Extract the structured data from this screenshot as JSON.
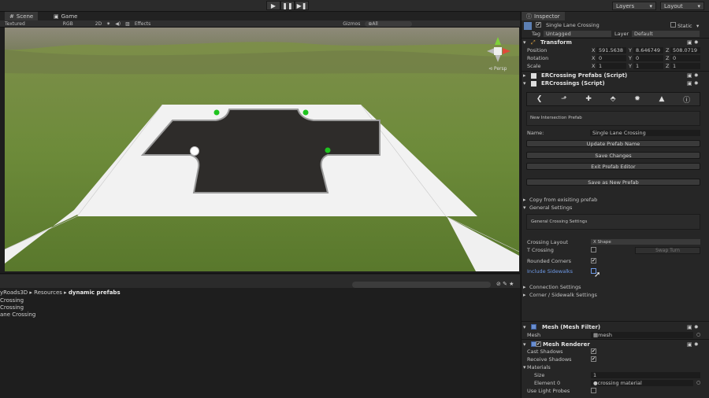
{
  "toolbar": {
    "layers_label": "Layers",
    "layout_label": "Layout",
    "play_icon": "▶",
    "pause_icon": "❚❚",
    "step_icon": "▶❚"
  },
  "tabs": {
    "scene": "Scene",
    "game": "Game",
    "inspector": "Inspector"
  },
  "scene_bar": {
    "shading": "Textured",
    "render_mode": "RGB",
    "mode_2d": "2D",
    "effects": "Effects",
    "gizmos": "Gizmos",
    "search_placeholder": "⊕All"
  },
  "viewport": {
    "persp_label": "⊲ Persp"
  },
  "project": {
    "breadcrumb_parts": [
      "yRoads3D",
      "Resources"
    ],
    "breadcrumb_current": "dynamic prefabs",
    "items": [
      "Crossing",
      "Crossing",
      "ane Crossing"
    ]
  },
  "inspector": {
    "object_name": "Single Lane Crossing",
    "static_label": "Static",
    "tag_label": "Tag",
    "tag_value": "Untagged",
    "layer_label": "Layer",
    "layer_value": "Default",
    "transform": {
      "title": "Transform",
      "position_label": "Position",
      "pos_x": "591.5638",
      "pos_y": "8.646749",
      "pos_z": "508.0719",
      "rotation_label": "Rotation",
      "rot_x": "0",
      "rot_y": "0",
      "rot_z": "0",
      "scale_label": "Scale",
      "scale_x": "1",
      "scale_y": "1",
      "scale_z": "1",
      "axis_x": "X",
      "axis_y": "Y",
      "axis_z": "Z"
    },
    "script1_title": "ERCrossing Prefabs (Script)",
    "script2_title": "ERCrossings (Script)",
    "tool_icons": [
      "❮",
      "⬏",
      "✚",
      "⬘",
      "✹",
      "▲",
      "ⓘ"
    ],
    "new_intersection_prefab": "New Intersection Prefab",
    "name_label": "Name:",
    "name_value": "Single Lane Crossing",
    "buttons": {
      "update_prefab_name": "Update Prefab Name",
      "save_changes": "Save Changes",
      "exit_prefab_editor": "Exit Prefab Editor",
      "save_as_new_prefab": "Save as New Prefab"
    },
    "copy_from_existing": "Copy from exisiting prefab",
    "general_settings": "General Settings",
    "general_crossing_settings": "General Crossing Settings",
    "crossing_layout_label": "Crossing Layout",
    "crossing_layout_value": "X Shape",
    "t_crossing_label": "T Crossing",
    "swap_turn_label": "Swap Turn",
    "rounded_corners_label": "Rounded Corners",
    "include_sidewalks_label": "Include Sidewalks",
    "connection_settings": "Connection Settings",
    "corner_sidewalk_settings": "Corner / Sidewalk Settings",
    "mesh_filter_title": "Mesh (Mesh Filter)",
    "mesh_label": "Mesh",
    "mesh_value": "mesh",
    "mesh_renderer_title": "Mesh Renderer",
    "cast_shadows_label": "Cast Shadows",
    "receive_shadows_label": "Receive Shadows",
    "materials_label": "Materials",
    "size_label": "Size",
    "size_value": "1",
    "element0_label": "Element 0",
    "element0_value": "crossing material",
    "use_light_probes_label": "Use Light Probes",
    "check_mark": "✔"
  },
  "colors": {
    "accent_link": "#6f9be8",
    "sidewalk": "#f2f2f2",
    "asphalt": "#2e2c2a",
    "grass": "#6d8a3a",
    "marker_green": "#1fc41f"
  }
}
